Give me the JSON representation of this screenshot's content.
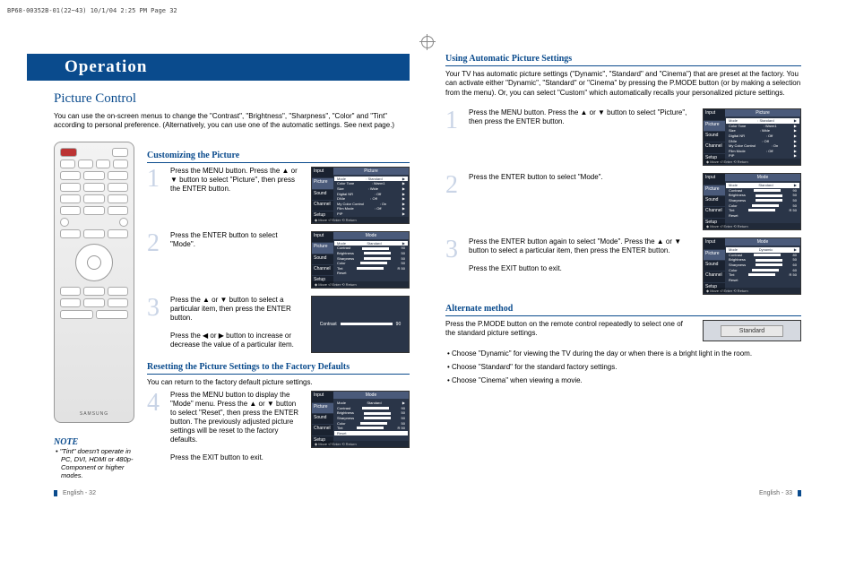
{
  "print_header": "BP68-00352B-01(22~43)  10/1/04  2:25 PM  Page 32",
  "op_title": "Operation",
  "section_title": "Picture Control",
  "intro": "You can use the on-screen menus to change the \"Contrast\", \"Brightness\", \"Sharpness\", \"Color\" and \"Tint\" according to personal preference. (Alternatively, you can use one of the automatic settings. See next page.)",
  "remote_brand": "SAMSUNG",
  "note_head": "NOTE",
  "note_body": "• \"Tint\" doesn't operate in PC, DVI, HDMI or 480p-Component or higher modes.",
  "custom_head": "Customizing the Picture",
  "custom_steps": [
    "Press the MENU button. Press the ▲ or ▼ button to select \"Picture\", then press the ENTER button.",
    "Press the ENTER button to select \"Mode\".",
    "Press the ▲ or ▼ button to select a particular item, then press the ENTER button.",
    "Press the ◀ or ▶ button to increase or decrease the value of a particular item."
  ],
  "reset_head": "Resetting the Picture Settings to the Factory Defaults",
  "reset_intro": "You can return to the factory default picture settings.",
  "reset_step": "Press the MENU button to display the \"Mode\" menu. Press the ▲ or ▼ button to select \"Reset\", then press the ENTER button. The previously adjusted picture settings will be reset to the factory defaults.",
  "reset_exit": "Press the EXIT button to exit.",
  "auto_head": "Using Automatic Picture Settings",
  "auto_intro": "Your TV has automatic picture settings (\"Dynamic\", \"Standard\" and \"Cinema\") that are preset at the factory. You can activate either \"Dynamic\", \"Standard\" or \"Cinema\" by pressing the P.MODE button (or by making a selection from the menu). Or, you can select \"Custom\" which automatically recalls your personalized picture settings.",
  "auto_steps": [
    "Press the MENU button. Press the ▲ or ▼ button to select \"Picture\", then press the ENTER button.",
    "Press the ENTER button to select \"Mode\".",
    "Press the ENTER button again to select \"Mode\". Press the ▲ or ▼ button to select a particular item, then press the ENTER button.",
    "Press the EXIT button to exit."
  ],
  "alt_head": "Alternate method",
  "alt_body": "Press the P.MODE button on the remote control repeatedly to select one of the standard picture settings.",
  "alt_badge": "Standard",
  "bullets": [
    "Choose \"Dynamic\" for viewing the TV during the day or when there is a bright light in the room.",
    "Choose \"Standard\" for the standard factory settings.",
    "Choose \"Cinema\" when viewing a movie."
  ],
  "foot_left": "English - 32",
  "foot_right": "English - 33",
  "osd_sidebar": [
    "Input",
    "Picture",
    "Sound",
    "Channel",
    "Setup"
  ],
  "osd_footer": "◆ Move    ⏎ Enter    ⟲ Return",
  "screens": {
    "picture": {
      "title": "Picture",
      "rows": [
        [
          "Mode",
          ": Standard",
          "▶"
        ],
        [
          "Color Tone",
          ": Warm1",
          "▶"
        ],
        [
          "Size",
          ": Wide",
          "▶"
        ],
        [
          "Digital NR",
          ": Off",
          "▶"
        ],
        [
          "DNIe",
          ": Off",
          "▶"
        ],
        [
          "My Color Control",
          ": On",
          "▶"
        ],
        [
          "Film Mode",
          ": Off",
          "▶"
        ],
        [
          "PIP",
          "",
          "▶"
        ]
      ],
      "hilite": 0
    },
    "mode_std": {
      "title": "Mode",
      "rows": [
        [
          "Mode",
          "Standard",
          "▶"
        ],
        [
          "Contrast",
          "",
          "90"
        ],
        [
          "Brightness",
          "",
          "50"
        ],
        [
          "Sharpness",
          "",
          "50"
        ],
        [
          "Color",
          "",
          "50"
        ],
        [
          "Tint",
          "G 50",
          "R 50"
        ],
        [
          "Reset",
          "",
          ""
        ]
      ],
      "hilite": 0,
      "bars": [
        1,
        2,
        3,
        4,
        5
      ]
    },
    "mode_dyn": {
      "title": "Mode",
      "rows": [
        [
          "Mode",
          "Dynamic",
          "▶"
        ],
        [
          "Contrast",
          "",
          "80"
        ],
        [
          "Brightness",
          "",
          "50"
        ],
        [
          "Sharpness",
          "",
          "60"
        ],
        [
          "Color",
          "",
          "60"
        ],
        [
          "Tint",
          "G 50",
          "R 50"
        ],
        [
          "Reset",
          "",
          ""
        ]
      ],
      "hilite": 0,
      "bars": [
        1,
        2,
        3,
        4,
        5
      ]
    },
    "mode_reset": {
      "title": "Mode",
      "rows": [
        [
          "Mode",
          "Standard",
          "▶"
        ],
        [
          "Contrast",
          "",
          "90"
        ],
        [
          "Brightness",
          "",
          "50"
        ],
        [
          "Sharpness",
          "",
          "50"
        ],
        [
          "Color",
          "",
          "50"
        ],
        [
          "Tint",
          "G 50",
          "R 50"
        ],
        [
          "Reset",
          "",
          ""
        ]
      ],
      "hilite": 6,
      "bars": [
        1,
        2,
        3,
        4,
        5
      ]
    },
    "slider": {
      "label": "Contrast",
      "val": "90"
    }
  }
}
